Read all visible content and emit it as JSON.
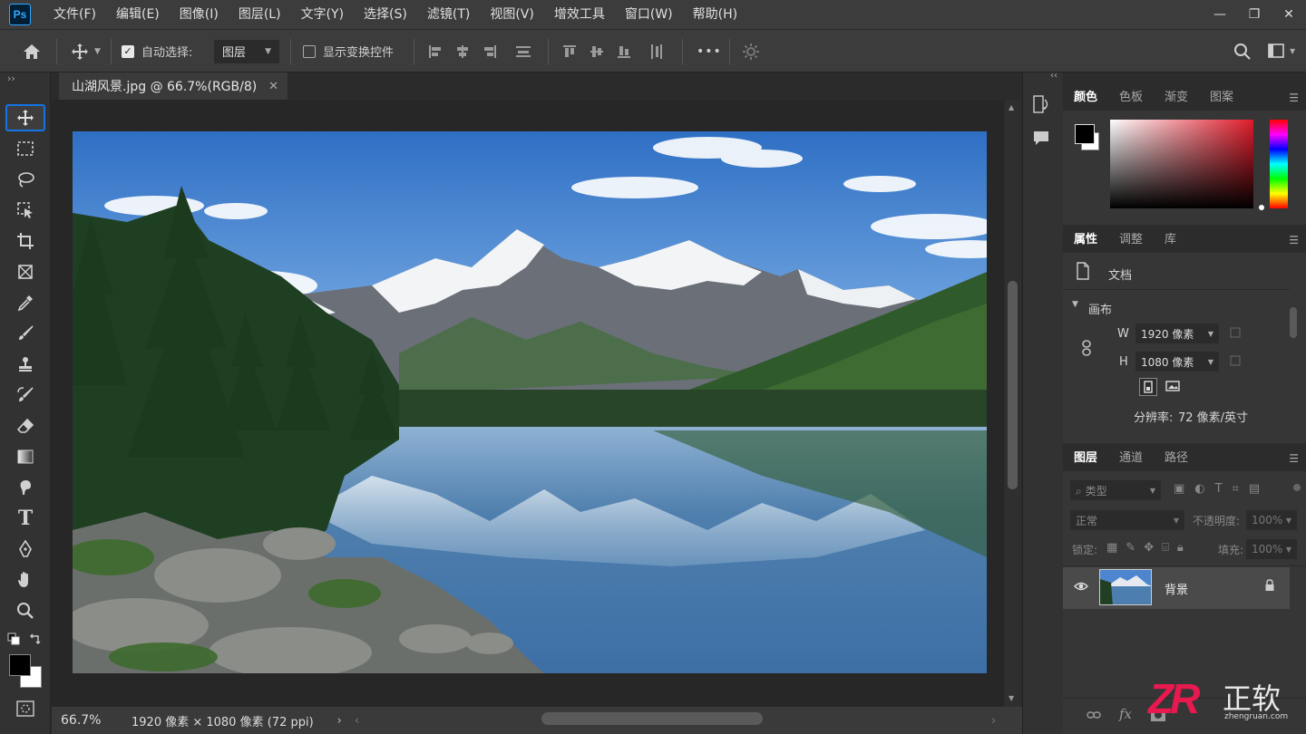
{
  "app": {
    "logo": "Ps"
  },
  "menu": [
    "文件(F)",
    "编辑(E)",
    "图像(I)",
    "图层(L)",
    "文字(Y)",
    "选择(S)",
    "滤镜(T)",
    "视图(V)",
    "增效工具",
    "窗口(W)",
    "帮助(H)"
  ],
  "window_controls": {
    "minimize": "—",
    "restore": "❐",
    "close": "✕"
  },
  "options": {
    "auto_select_label": "自动选择:",
    "auto_select_checked": true,
    "auto_select_target": "图层",
    "show_transform_label": "显示变换控件",
    "show_transform_checked": false,
    "more": "•••"
  },
  "toolbar": {
    "collapse": "››",
    "tools": [
      "move-tool",
      "rectangular-marquee-tool",
      "lasso-tool",
      "object-selection-tool",
      "crop-tool",
      "frame-tool",
      "eyedropper-tool",
      "brush-tool",
      "clone-stamp-tool",
      "history-brush-tool",
      "eraser-tool",
      "gradient-tool",
      "smudge-tool",
      "type-tool",
      "pen-tool",
      "hand-tool",
      "zoom-tool"
    ],
    "type_glyph": "T",
    "foreground": "#000000",
    "background": "#ffffff"
  },
  "document": {
    "tab_title": "山湖风景.jpg @ 66.7%(RGB/8)",
    "close": "✕"
  },
  "status": {
    "zoom": "66.7%",
    "doc_info": "1920 像素 × 1080 像素 (72 ppi)",
    "arrow": "›",
    "scroll_left": "‹",
    "scroll_right": "›"
  },
  "panels": {
    "top_collapse": "‹‹",
    "color_tabs": [
      "颜色",
      "色板",
      "渐变",
      "图案"
    ],
    "properties_tabs": [
      "属性",
      "调整",
      "库"
    ],
    "properties": {
      "doc_label": "文档",
      "canvas_section": "画布",
      "w_label": "W",
      "w_value": "1920 像素",
      "h_label": "H",
      "h_value": "1080 像素",
      "resolution_label": "分辨率:",
      "resolution_value": "72 像素/英寸"
    },
    "layers_tabs": [
      "图层",
      "通道",
      "路径"
    ],
    "layers": {
      "filter_placeholder": "类型",
      "blend_mode": "正常",
      "opacity_label": "不透明度:",
      "opacity_value": "100%",
      "lock_label": "锁定:",
      "fill_label": "填充:",
      "fill_value": "100%",
      "items": [
        {
          "name": "背景",
          "visible": true,
          "locked": true
        }
      ],
      "footer_fx": "fx"
    }
  },
  "watermark": {
    "logo_text": "ZR",
    "cn_text": "正软",
    "url": "zhengruan.com"
  },
  "colors": {
    "accent": "#1473e6",
    "ui_bg": "#3c3c3c",
    "panel_bg": "#363636"
  }
}
